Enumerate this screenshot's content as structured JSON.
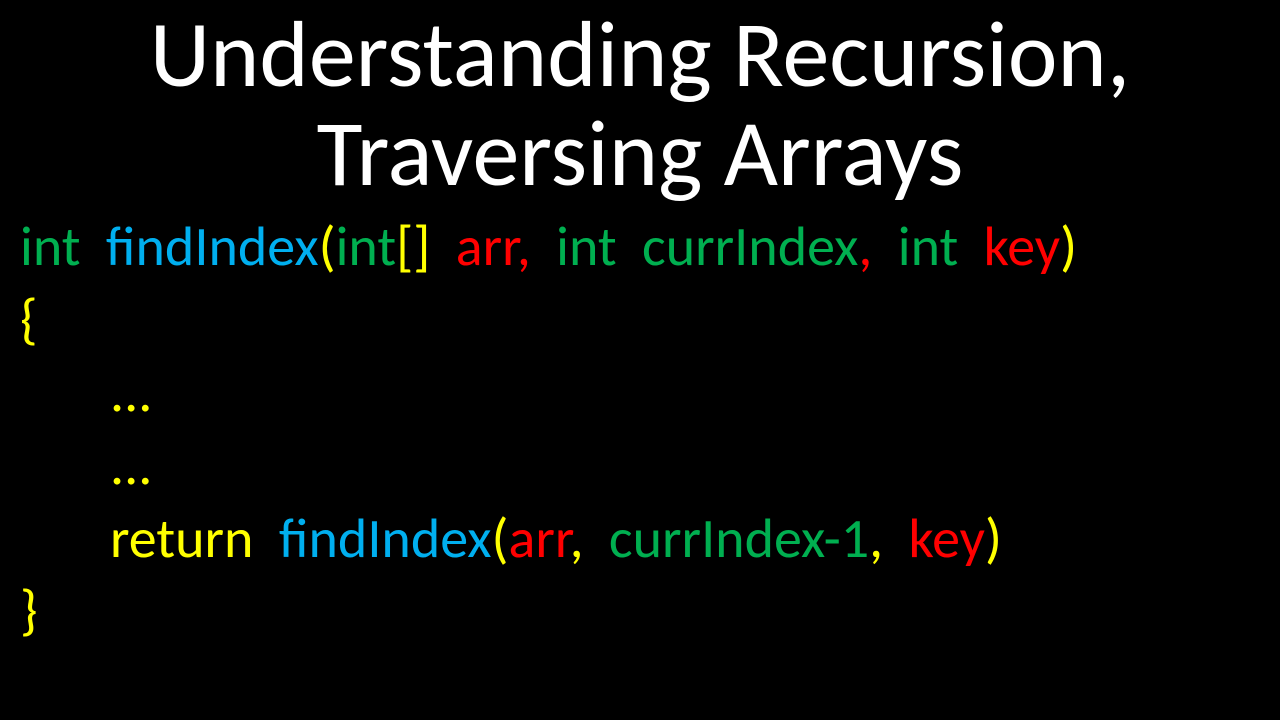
{
  "title": {
    "line1": "Understanding Recursion,",
    "line2": "Traversing Arrays"
  },
  "code": {
    "sig": {
      "int1": "int",
      "func": "findIndex",
      "open": "(",
      "int2": "int",
      "brk": "[]",
      "arr": "arr",
      "comma1": ",",
      "int3": "int",
      "curr": "currIndex",
      "comma2": ",",
      "int4": "int",
      "key": "key",
      "close": ")"
    },
    "obrace": "{",
    "dots1": "...",
    "dots2": "...",
    "ret": {
      "return": "return",
      "func": "findIndex",
      "open": "(",
      "arr": "arr",
      "comma1": ",",
      "curr": "currIndex-1",
      "comma2": ",",
      "key": "key",
      "close": ")"
    },
    "cbrace": "}"
  }
}
